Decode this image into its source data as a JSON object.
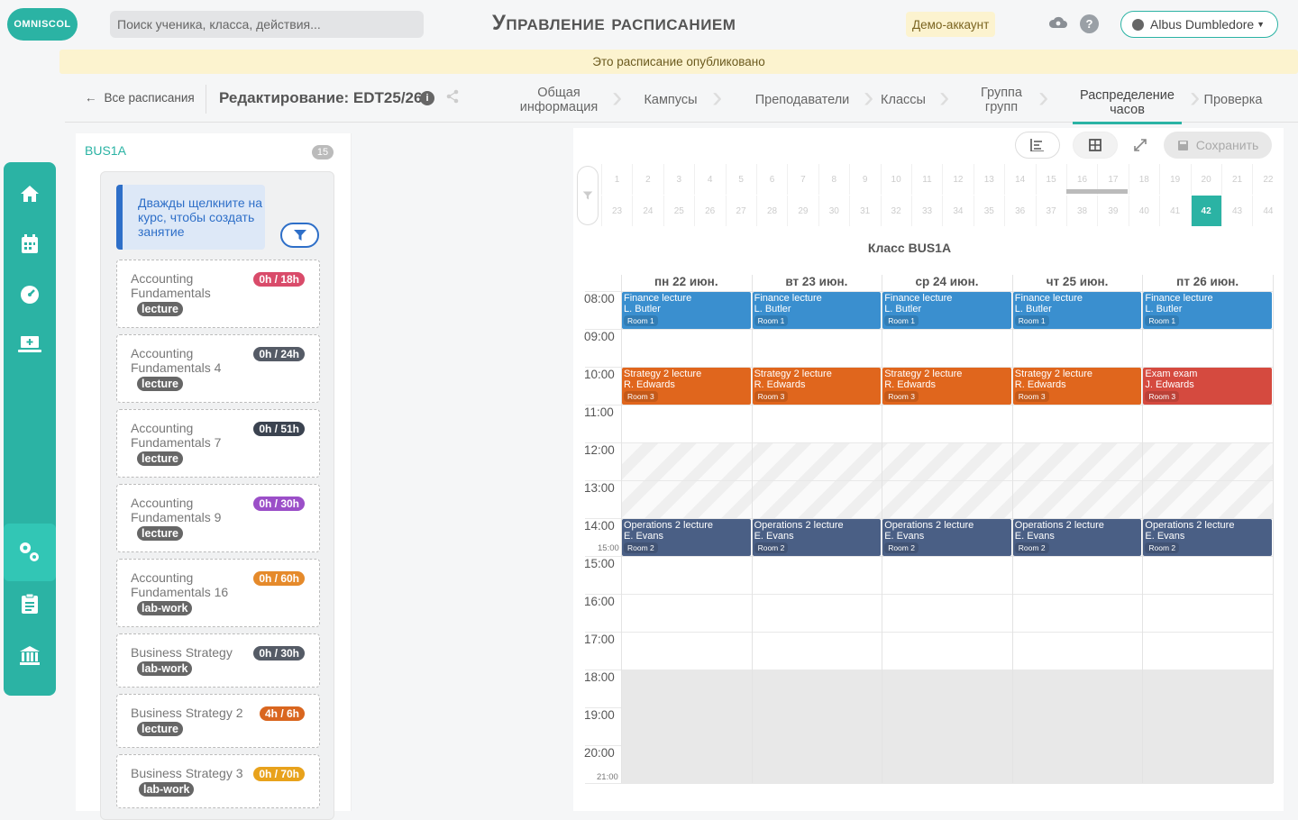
{
  "header": {
    "logo": "OMNISCOL",
    "search_placeholder": "Поиск ученика, класса, действия...",
    "title": "Управление расписанием",
    "demo": "Демо-аккаунт",
    "help": "?",
    "user": "Albus Dumbledore"
  },
  "banner": "Это расписание опубликовано",
  "wizard": {
    "back": "Все расписания",
    "title": "Редактирование: EDT25/26",
    "steps": [
      {
        "label": "Общая информация"
      },
      {
        "label": "Кампусы"
      },
      {
        "label": "Преподаватели"
      },
      {
        "label": "Классы"
      },
      {
        "label": "Группа групп"
      },
      {
        "label": "Распределение часов"
      },
      {
        "label": "Проверка"
      }
    ]
  },
  "left": {
    "class_name": "BUS1A",
    "count": "15",
    "hint": "Дважды щелкните на курс, чтобы создать занятие",
    "courses": [
      {
        "name": "Accounting Fundamentals",
        "hours": "0h / 18h",
        "color": "#d94b6a",
        "type": "lecture"
      },
      {
        "name": "Accounting Fundamentals 4",
        "hours": "0h / 24h",
        "color": "#555b66",
        "type": "lecture"
      },
      {
        "name": "Accounting Fundamentals 7",
        "hours": "0h / 51h",
        "color": "#3b4350",
        "type": "lecture"
      },
      {
        "name": "Accounting Fundamentals 9",
        "hours": "0h / 30h",
        "color": "#9b4fc8",
        "type": "lecture"
      },
      {
        "name": "Accounting Fundamentals 16",
        "hours": "0h / 60h",
        "color": "#e58a2b",
        "type": "lab-work"
      },
      {
        "name": "Business Strategy",
        "hours": "0h / 30h",
        "color": "#555b66",
        "type": "lab-work"
      },
      {
        "name": "Business Strategy 2",
        "hours": "4h / 6h",
        "color": "#d9661f",
        "type": "lecture"
      },
      {
        "name": "Business Strategy 3",
        "hours": "0h / 70h",
        "color": "#e8a21c",
        "type": "lab-work"
      }
    ]
  },
  "calendar": {
    "save": "Сохранить",
    "title": "Класс BUS1A",
    "weeks_row1": [
      "1",
      "2",
      "3",
      "4",
      "5",
      "6",
      "7",
      "8",
      "9",
      "10",
      "11",
      "12",
      "13",
      "14",
      "15",
      "16",
      "17",
      "18",
      "19",
      "20",
      "21",
      "22"
    ],
    "weeks_row2": [
      "23",
      "24",
      "25",
      "26",
      "27",
      "28",
      "29",
      "30",
      "31",
      "32",
      "33",
      "34",
      "35",
      "36",
      "37",
      "38",
      "39",
      "40",
      "41",
      "42",
      "43",
      "44"
    ],
    "selected_week": "42",
    "days": [
      "пн 22 июн.",
      "вт 23 июн.",
      "ср 24 июн.",
      "чт 25 июн.",
      "пт 26 июн."
    ],
    "hours": [
      "08:00",
      "09:00",
      "10:00",
      "11:00",
      "12:00",
      "13:00",
      "14:00",
      "15:00",
      "16:00",
      "17:00",
      "18:00",
      "19:00",
      "20:00"
    ],
    "small_labels": [
      "15:00",
      "21:00"
    ],
    "events": [
      {
        "day": 0,
        "slot": 0,
        "title": "Finance  lecture",
        "teacher": "L. Butler",
        "room": "Room 1",
        "color": "#3a8fcf"
      },
      {
        "day": 1,
        "slot": 0,
        "title": "Finance  lecture",
        "teacher": "L. Butler",
        "room": "Room 1",
        "color": "#3a8fcf"
      },
      {
        "day": 2,
        "slot": 0,
        "title": "Finance  lecture",
        "teacher": "L. Butler",
        "room": "Room 1",
        "color": "#3a8fcf"
      },
      {
        "day": 3,
        "slot": 0,
        "title": "Finance  lecture",
        "teacher": "L. Butler",
        "room": "Room 1",
        "color": "#3a8fcf"
      },
      {
        "day": 4,
        "slot": 0,
        "title": "Finance  lecture",
        "teacher": "L. Butler",
        "room": "Room 1",
        "color": "#3a8fcf"
      },
      {
        "day": 0,
        "slot": 2,
        "title": "Strategy 2  lecture",
        "teacher": "R. Edwards",
        "room": "Room 3",
        "color": "#e0661d"
      },
      {
        "day": 1,
        "slot": 2,
        "title": "Strategy 2  lecture",
        "teacher": "R. Edwards",
        "room": "Room 3",
        "color": "#e0661d"
      },
      {
        "day": 2,
        "slot": 2,
        "title": "Strategy 2  lecture",
        "teacher": "R. Edwards",
        "room": "Room 3",
        "color": "#e0661d"
      },
      {
        "day": 3,
        "slot": 2,
        "title": "Strategy 2  lecture",
        "teacher": "R. Edwards",
        "room": "Room 3",
        "color": "#e0661d"
      },
      {
        "day": 4,
        "slot": 2,
        "title": "Exam  exam",
        "teacher": "J. Edwards",
        "room": "Room 3",
        "color": "#d54a3f"
      },
      {
        "day": 0,
        "slot": 6,
        "title": "Operations 2  lecture",
        "teacher": "E. Evans",
        "room": "Room 2",
        "color": "#4a5f85"
      },
      {
        "day": 1,
        "slot": 6,
        "title": "Operations 2  lecture",
        "teacher": "E. Evans",
        "room": "Room 2",
        "color": "#4a5f85"
      },
      {
        "day": 2,
        "slot": 6,
        "title": "Operations 2  lecture",
        "teacher": "E. Evans",
        "room": "Room 2",
        "color": "#4a5f85"
      },
      {
        "day": 3,
        "slot": 6,
        "title": "Operations 2  lecture",
        "teacher": "E. Evans",
        "room": "Room 2",
        "color": "#4a5f85"
      },
      {
        "day": 4,
        "slot": 6,
        "title": "Operations 2  lecture",
        "teacher": "E. Evans",
        "room": "Room 2",
        "color": "#4a5f85"
      }
    ]
  },
  "nav_icons": [
    "home-icon",
    "calendar-icon",
    "dashboard-icon",
    "monitor-icon",
    "settings-icon",
    "clipboard-icon",
    "institution-icon"
  ]
}
